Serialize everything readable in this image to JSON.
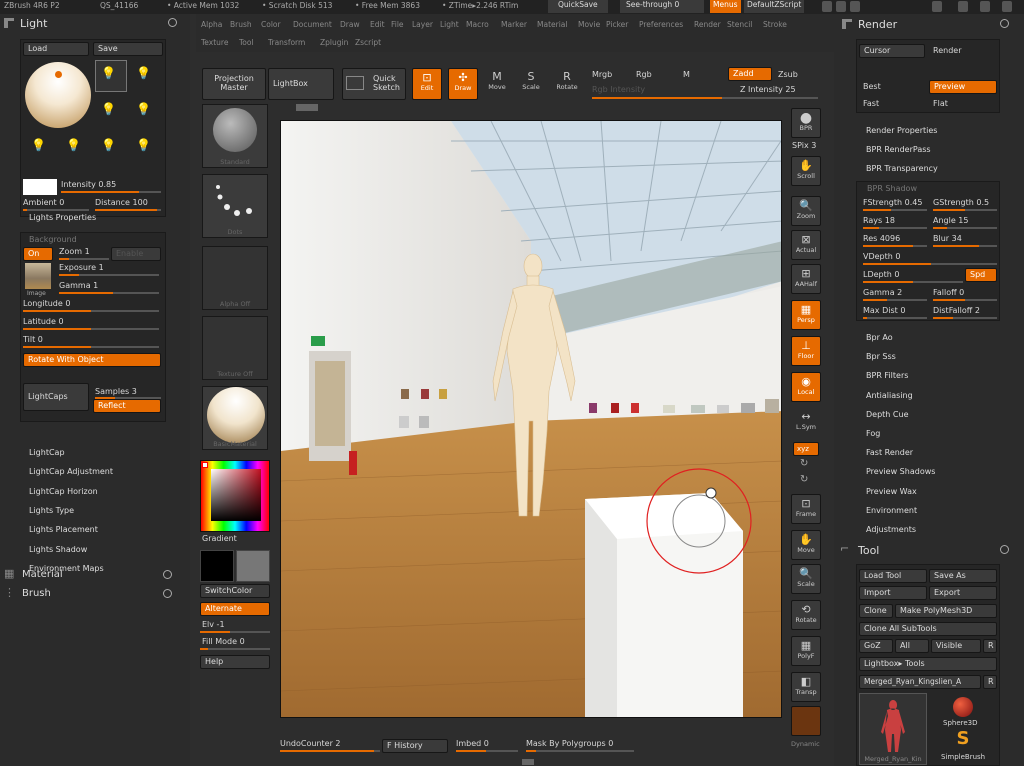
{
  "topbar": {
    "app": "ZBrush 4R6 P2",
    "qs": "QS_41166",
    "active_mem": "• Active Mem 1032",
    "scratch": "• Scratch Disk 513",
    "free_mem": "• Free Mem 3863",
    "ztime": "• ZTime▸2.246 RTim",
    "quicksave": "QuickSave",
    "seethrough": "See-through  0",
    "menus": "Menus",
    "script": "DefaultZScript"
  },
  "menus": {
    "row1": [
      "Alpha",
      "Brush",
      "Color",
      "Document",
      "Draw",
      "Edit",
      "File",
      "Layer",
      "Light",
      "Macro",
      "Marker",
      "Material",
      "Movie",
      "Picker",
      "Preferences",
      "Render",
      "Stencil",
      "Stroke"
    ],
    "row2": [
      "Texture",
      "Tool",
      "Transform",
      "Zplugin",
      "Zscript"
    ]
  },
  "toolbar": {
    "projection_master": "Projection Master",
    "lightbox": "LightBox",
    "quick_sketch": "Quick Sketch",
    "edit": "Edit",
    "draw": "Draw",
    "move": "Move",
    "scale": "Scale",
    "rotate": "Rotate",
    "mrgb": "Mrgb",
    "rgb": "Rgb",
    "m": "M",
    "rgb_intensity": "Rgb Intensity",
    "zadd": "Zadd",
    "zsub": "Zsub",
    "z_intensity": "Z Intensity 25"
  },
  "light": {
    "title": "Light",
    "load": "Load",
    "save": "Save",
    "intensity": "Intensity 0.85",
    "ambient": "Ambient 0",
    "distance": "Distance 100",
    "properties": "Lights Properties",
    "background": "Background",
    "on": "On",
    "zoom": "Zoom 1",
    "enable": "Enable",
    "exposure": "Exposure 1",
    "gamma": "Gamma 1",
    "image": "Image",
    "longitude": "Longitude 0",
    "latitude": "Latitude 0",
    "tilt": "Tilt 0",
    "rotate_with_object": "Rotate With Object",
    "lightcaps": "LightCaps",
    "samples": "Samples 3",
    "reflect": "Reflect",
    "sub_items": [
      "LightCap",
      "LightCap Adjustment",
      "LightCap Horizon",
      "Lights Type",
      "Lights Placement",
      "Lights Shadow",
      "Environment Maps"
    ]
  },
  "material": {
    "title": "Material"
  },
  "brush": {
    "title": "Brush"
  },
  "left_shelf": {
    "standard": "Standard",
    "dots": "Dots",
    "alpha_off": "Alpha Off",
    "texture_off": "Texture Off",
    "matcap": "BasicMaterial",
    "gradient": "Gradient",
    "switchcolor": "SwitchColor",
    "alternate": "Alternate",
    "elv": "Elv -1",
    "fill_mode": "Fill Mode 0",
    "help": "Help"
  },
  "right_shelf": {
    "bpr": "BPR",
    "spix": "SPix 3",
    "scroll": "Scroll",
    "zoom": "Zoom",
    "actual": "Actual",
    "aahalf": "AAHalf",
    "persp": "Persp",
    "floor": "Floor",
    "local": "Local",
    "lsym": "L.Sym",
    "xyz": "xyz",
    "frame": "Frame",
    "move": "Move",
    "scale": "Scale",
    "rotate": "Rotate",
    "polyf": "PolyF",
    "transp": "Transp",
    "dynamic": "Dynamic"
  },
  "render": {
    "title": "Render",
    "cursor": "Cursor",
    "render": "Render",
    "best": "Best",
    "preview": "Preview",
    "fast": "Fast",
    "flat": "Flat",
    "render_properties": "Render Properties",
    "bpr_renderpass": "BPR RenderPass",
    "bpr_transparency": "BPR Transparency",
    "bpr_shadow": "BPR Shadow",
    "fstrength": "FStrength 0.45",
    "gstrength": "GStrength 0.5",
    "rays": "Rays 18",
    "angle": "Angle 15",
    "res": "Res 4096",
    "blur": "Blur 34",
    "vdepth": "VDepth 0",
    "ldepth": "LDepth 0",
    "spd": "Spd",
    "gamma": "Gamma 2",
    "falloff": "Falloff 0",
    "maxdist": "Max Dist 0",
    "distfalloff": "DistFalloff 2",
    "items": [
      "Bpr Ao",
      "Bpr Sss",
      "BPR Filters",
      "Antialiasing",
      "Depth Cue",
      "Fog",
      "Fast Render",
      "Preview Shadows",
      "Preview Wax",
      "Environment",
      "Adjustments"
    ]
  },
  "tool": {
    "title": "Tool",
    "load_tool": "Load Tool",
    "save_as": "Save As",
    "import": "Import",
    "export": "Export",
    "clone": "Clone",
    "make_polymesh": "Make PolyMesh3D",
    "clone_all": "Clone All SubTools",
    "goz": "GoZ",
    "all": "All",
    "visible": "Visible",
    "r": "R",
    "lightbox_tools": "Lightbox▸ Tools",
    "current_tool": "Merged_Ryan_Kingslien_A",
    "tool_r": "R",
    "sphere3d": "Sphere3D",
    "simplebrush": "SimpleBrush",
    "thumb_caption": "Merged_Ryan_Kin"
  },
  "bottombar": {
    "undo": "UndoCounter 2",
    "history": "F History",
    "imbed": "Imbed 0",
    "mask": "Mask By Polygroups 0"
  },
  "colors": {
    "accent": "#e66a00",
    "panel": "#262626",
    "background": "#2d2d2d"
  }
}
